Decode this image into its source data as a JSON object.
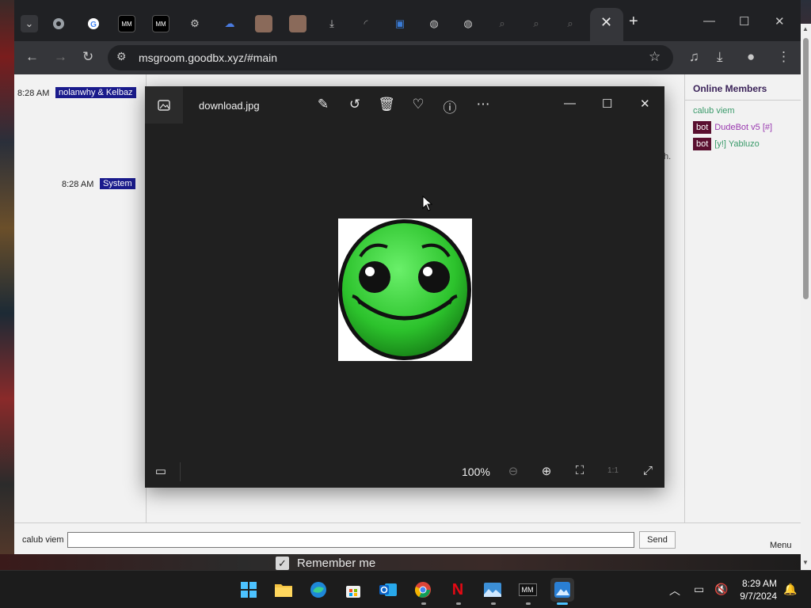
{
  "browser": {
    "url": "msgroom.goodbx.xyz/#main",
    "tab_icons": [
      "chevron-down-icon",
      "chrome-icon",
      "google-icon",
      "msgroom-icon",
      "msgroom-icon",
      "gear-icon",
      "cloud-icon",
      "avatar-icon",
      "avatar-icon",
      "download-icon",
      "loading-icon",
      "terminal-icon",
      "globe-icon",
      "globe-icon",
      "search-icon",
      "search-icon",
      "search-icon"
    ],
    "active_tab_close": "✕",
    "new_tab": "+"
  },
  "chat": {
    "messages": [
      {
        "time": "8:28 AM",
        "user": "nolanwhy & Kelbaz"
      },
      {
        "time": "8:28 AM",
        "user": "System"
      }
    ],
    "stray_text": "h.",
    "nickname": "calub viem",
    "message_value": "",
    "send_label": "Send",
    "menu_label": "Menu"
  },
  "members": {
    "title": "Online Members",
    "list": [
      {
        "badge": "",
        "name": "calub viem",
        "color": "#3a9a6a"
      },
      {
        "badge": "bot",
        "name": "DudeBot v5 [#]",
        "color": "#9a3ab0"
      },
      {
        "badge": "bot",
        "name": "[y!] Yabluzo",
        "color": "#3a9a6a"
      }
    ]
  },
  "viewer": {
    "filename": "download.jpg",
    "zoom": "100%",
    "ratio_label": "1:1"
  },
  "page_footer": {
    "remember_me": "Remember me"
  },
  "taskbar": {
    "apps": [
      "windows-start-icon",
      "file-explorer-icon",
      "edge-icon",
      "store-icon",
      "outlook-icon",
      "chrome-icon",
      "netflix-icon",
      "photos-icon",
      "msgroom-icon",
      "photos-viewer-icon"
    ],
    "time": "8:29 AM",
    "date": "9/7/2024"
  },
  "colors": {
    "chat_user_bg": "#1a1b8c",
    "bot_badge_bg": "#5a1030",
    "members_title": "#3b2359",
    "viewer_bg": "#202020"
  }
}
